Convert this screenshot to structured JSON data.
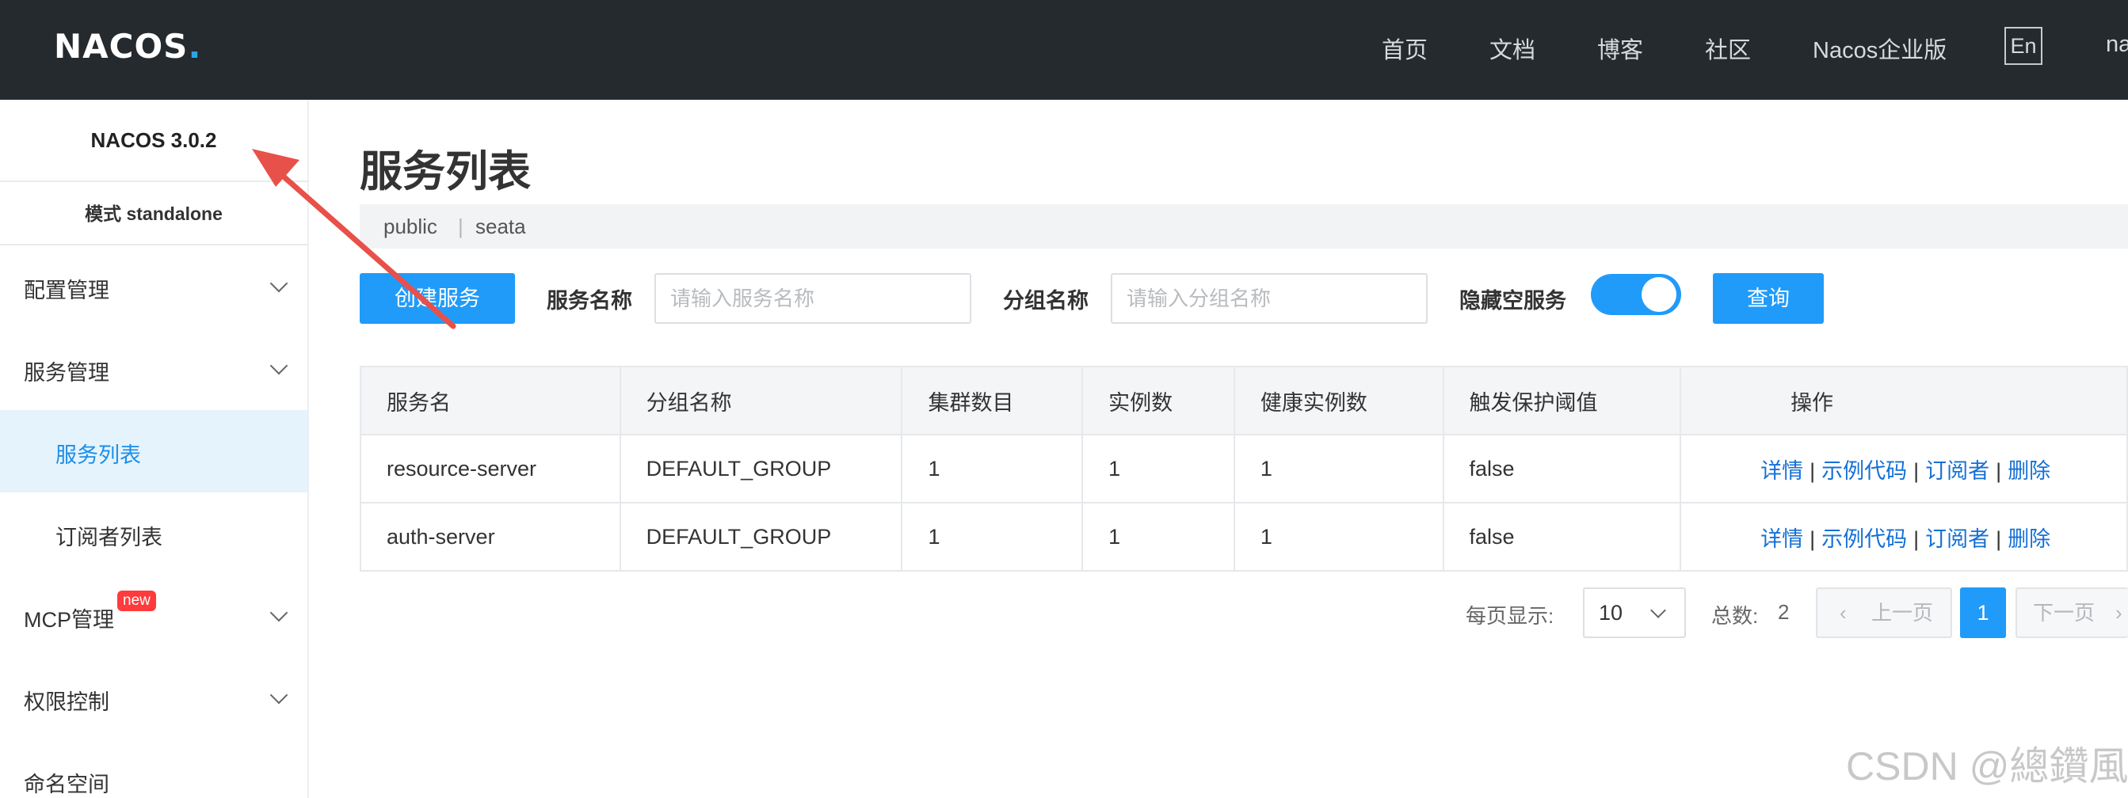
{
  "header": {
    "logo": {
      "part1": "NA",
      "part2": "COS",
      "dot": "."
    },
    "nav": [
      "首页",
      "文档",
      "博客",
      "社区",
      "Nacos企业版"
    ],
    "lang_button": "En",
    "user_partial": "na"
  },
  "sidebar": {
    "version": "NACOS 3.0.2",
    "mode": "模式 standalone",
    "items": [
      {
        "label": "配置管理",
        "icon": "chevron-down-icon"
      },
      {
        "label": "服务管理",
        "icon": "chevron-down-icon"
      },
      {
        "label": "服务列表"
      },
      {
        "label": "订阅者列表"
      },
      {
        "label": "MCP管理",
        "badge": "new",
        "icon": "chevron-down-icon"
      },
      {
        "label": "权限控制",
        "icon": "chevron-down-icon"
      },
      {
        "label": "命名空间"
      }
    ]
  },
  "main": {
    "title": "服务列表",
    "breadcrumb": {
      "namespace": "public",
      "separator": "|",
      "current": "seata"
    },
    "toolbar": {
      "create_button": "创建服务",
      "service_name_label": "服务名称",
      "service_name_placeholder": "请输入服务名称",
      "group_name_label": "分组名称",
      "group_name_placeholder": "请输入分组名称",
      "hide_empty_label": "隐藏空服务",
      "hide_empty_on": true,
      "query_button": "查询"
    },
    "table": {
      "columns": [
        "服务名",
        "分组名称",
        "集群数目",
        "实例数",
        "健康实例数",
        "触发保护阈值",
        "操作"
      ],
      "rows": [
        {
          "service": "resource-server",
          "group": "DEFAULT_GROUP",
          "clusters": "1",
          "instances": "1",
          "healthy": "1",
          "threshold": "false"
        },
        {
          "service": "auth-server",
          "group": "DEFAULT_GROUP",
          "clusters": "1",
          "instances": "1",
          "healthy": "1",
          "threshold": "false"
        }
      ],
      "actions": [
        "详情",
        "示例代码",
        "订阅者",
        "删除"
      ],
      "action_separator": "|"
    },
    "pagination": {
      "per_page_label": "每页显示:",
      "per_page_value": "10",
      "total_label": "总数:",
      "total_value": "2",
      "prev": "上一页",
      "current": "1",
      "next": "下一页"
    }
  },
  "watermark": "CSDN @總鑽風",
  "colors": {
    "primary": "#209bfa",
    "header_bg": "#252a2f",
    "link": "#1570d6",
    "annotation": "#e8504a",
    "badge": "#ff3b3b"
  }
}
